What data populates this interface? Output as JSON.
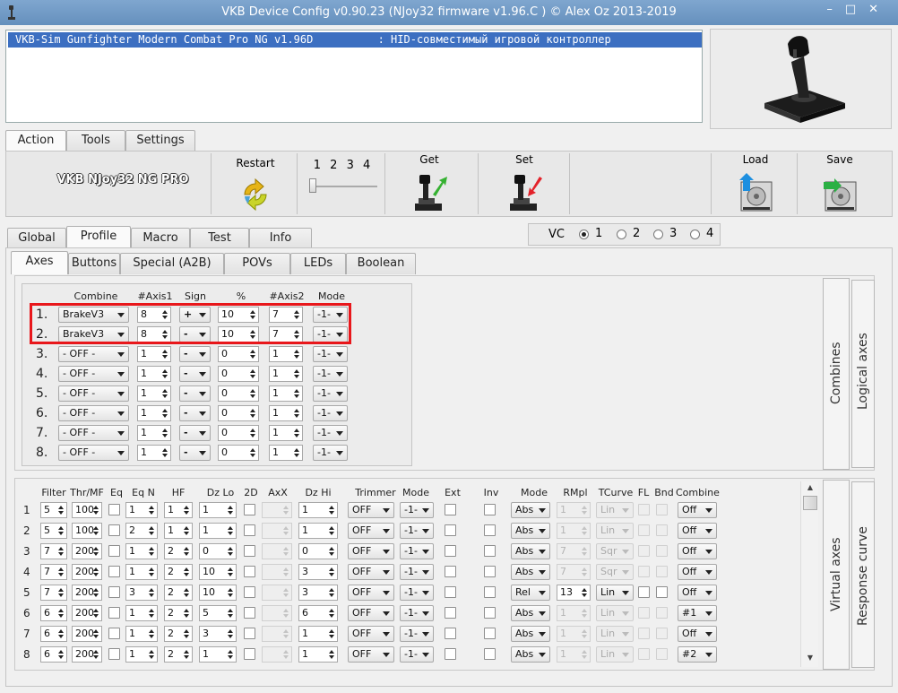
{
  "window": {
    "title": "VKB Device Config v0.90.23 (NJoy32 firmware v1.96.C  ) © Alex Oz 2013-2019",
    "controls": "–□✕"
  },
  "device_list": {
    "name": "VKB-Sim Gunfighter Modern Combat Pro NG v1.96D",
    "type": ": HID-совместимый игровой контроллер"
  },
  "main_tabs": [
    "Action",
    "Tools",
    "Settings"
  ],
  "action": {
    "device_label": "VKB NJoy32 NG PRO",
    "restart": "Restart",
    "slider_nums": [
      "1",
      "2",
      "3",
      "4"
    ],
    "get": "Get",
    "set": "Set",
    "load": "Load",
    "save": "Save"
  },
  "profile_tabs": [
    "Global",
    "Profile",
    "Macro",
    "Test",
    "Info"
  ],
  "vc": {
    "label": "VC",
    "options": [
      "1",
      "2",
      "3",
      "4"
    ],
    "selected": "1"
  },
  "sub_tabs": [
    "Axes",
    "Buttons",
    "Special (A2B)",
    "POVs",
    "LEDs",
    "Boolean"
  ],
  "combines": {
    "headers": [
      "Combine",
      "#Axis1",
      "Sign",
      "%",
      "#Axis2",
      "Mode"
    ],
    "rows": [
      {
        "n": "1.",
        "combine": "BrakeV3",
        "axis1": "8",
        "sign": "+",
        "pct": "10",
        "axis2": "7",
        "mode": "-1-"
      },
      {
        "n": "2.",
        "combine": "BrakeV3",
        "axis1": "8",
        "sign": "-",
        "pct": "10",
        "axis2": "7",
        "mode": "-1-"
      },
      {
        "n": "3.",
        "combine": "- OFF -",
        "axis1": "1",
        "sign": "-",
        "pct": "0",
        "axis2": "1",
        "mode": "-1-"
      },
      {
        "n": "4.",
        "combine": "- OFF -",
        "axis1": "1",
        "sign": "-",
        "pct": "0",
        "axis2": "1",
        "mode": "-1-"
      },
      {
        "n": "5.",
        "combine": "- OFF -",
        "axis1": "1",
        "sign": "-",
        "pct": "0",
        "axis2": "1",
        "mode": "-1-"
      },
      {
        "n": "6.",
        "combine": "- OFF -",
        "axis1": "1",
        "sign": "-",
        "pct": "0",
        "axis2": "1",
        "mode": "-1-"
      },
      {
        "n": "7.",
        "combine": "- OFF -",
        "axis1": "1",
        "sign": "-",
        "pct": "0",
        "axis2": "1",
        "mode": "-1-"
      },
      {
        "n": "8.",
        "combine": "- OFF -",
        "axis1": "1",
        "sign": "-",
        "pct": "0",
        "axis2": "1",
        "mode": "-1-"
      }
    ]
  },
  "side_tabs": {
    "combines": "Combines",
    "logical": "Logical axes",
    "virtual": "Virtual axes",
    "response": "Response curve"
  },
  "vaxes": {
    "headers": [
      "Filter",
      "Thr/MF",
      "Eq",
      "Eq N",
      "HF",
      "Dz Lo",
      "2D",
      "AxX",
      "Dz Hi",
      "Trimmer",
      "Mode",
      "Ext",
      "Inv",
      "Mode",
      "RMpl",
      "TCurve",
      "FL",
      "Bnd",
      "Combine"
    ],
    "rows": [
      {
        "n": "1",
        "filter": "5",
        "thr": "100",
        "eqn": "1",
        "hf": "1",
        "dzlo": "1",
        "dzhi": "1",
        "trim": "OFF",
        "mode": "-1-",
        "mode2": "Abs",
        "rmpl": "1",
        "rmpl_en": false,
        "tcurve": "Lin",
        "tc_en": false,
        "combine": "Off"
      },
      {
        "n": "2",
        "filter": "5",
        "thr": "100",
        "eqn": "2",
        "hf": "1",
        "dzlo": "1",
        "dzhi": "1",
        "trim": "OFF",
        "mode": "-1-",
        "mode2": "Abs",
        "rmpl": "1",
        "rmpl_en": false,
        "tcurve": "Lin",
        "tc_en": false,
        "combine": "Off"
      },
      {
        "n": "3",
        "filter": "7",
        "thr": "200",
        "eqn": "1",
        "hf": "2",
        "dzlo": "0",
        "dzhi": "0",
        "trim": "OFF",
        "mode": "-1-",
        "mode2": "Abs",
        "rmpl": "7",
        "rmpl_en": false,
        "tcurve": "Sqr",
        "tc_en": false,
        "combine": "Off"
      },
      {
        "n": "4",
        "filter": "7",
        "thr": "200",
        "eqn": "1",
        "hf": "2",
        "dzlo": "10",
        "dzhi": "3",
        "trim": "OFF",
        "mode": "-1-",
        "mode2": "Abs",
        "rmpl": "7",
        "rmpl_en": false,
        "tcurve": "Sqr",
        "tc_en": false,
        "combine": "Off"
      },
      {
        "n": "5",
        "filter": "7",
        "thr": "200",
        "eqn": "3",
        "hf": "2",
        "dzlo": "10",
        "dzhi": "3",
        "trim": "OFF",
        "mode": "-1-",
        "mode2": "Rel",
        "rmpl": "13",
        "rmpl_en": true,
        "tcurve": "Lin",
        "tc_en": true,
        "combine": "Off"
      },
      {
        "n": "6",
        "filter": "6",
        "thr": "200",
        "eqn": "1",
        "hf": "2",
        "dzlo": "5",
        "dzhi": "6",
        "trim": "OFF",
        "mode": "-1-",
        "mode2": "Abs",
        "rmpl": "1",
        "rmpl_en": false,
        "tcurve": "Lin",
        "tc_en": false,
        "combine": "#1"
      },
      {
        "n": "7",
        "filter": "6",
        "thr": "200",
        "eqn": "1",
        "hf": "2",
        "dzlo": "3",
        "dzhi": "1",
        "trim": "OFF",
        "mode": "-1-",
        "mode2": "Abs",
        "rmpl": "1",
        "rmpl_en": false,
        "tcurve": "Lin",
        "tc_en": false,
        "combine": "Off"
      },
      {
        "n": "8",
        "filter": "6",
        "thr": "200",
        "eqn": "1",
        "hf": "2",
        "dzlo": "1",
        "dzhi": "1",
        "trim": "OFF",
        "mode": "-1-",
        "mode2": "Abs",
        "rmpl": "1",
        "rmpl_en": false,
        "tcurve": "Lin",
        "tc_en": false,
        "combine": "#2"
      }
    ]
  }
}
